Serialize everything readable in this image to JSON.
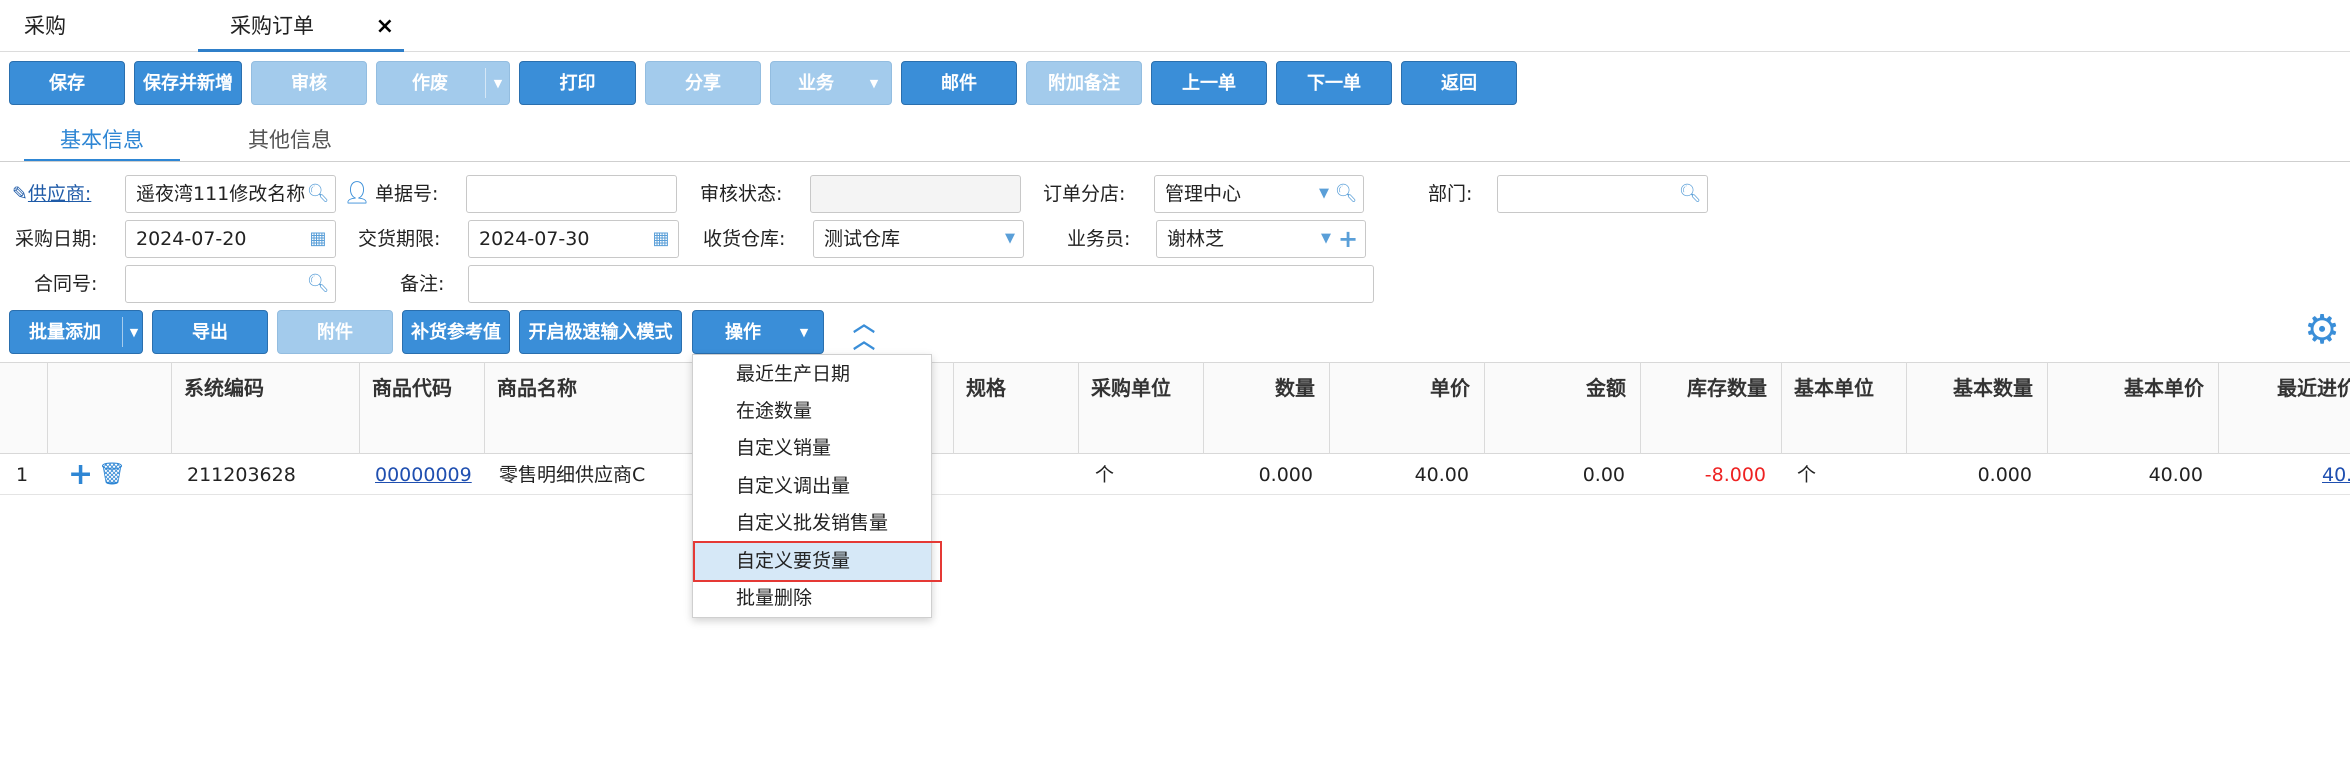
{
  "tabs": [
    {
      "label": "采购"
    },
    {
      "label": "采购订单",
      "close": "×"
    }
  ],
  "toolbar": {
    "save": "保存",
    "save_new": "保存并新增",
    "audit": "审核",
    "void": "作废",
    "print": "打印",
    "share": "分享",
    "business": "业务",
    "mail": "邮件",
    "attach_note": "附加备注",
    "prev": "上一单",
    "next": "下一单",
    "back": "返回"
  },
  "subtabs": {
    "basic": "基本信息",
    "other": "其他信息"
  },
  "form": {
    "supplier_label": "供应商:",
    "supplier_value": "遥夜湾111修改名称",
    "doc_no_label": "单据号:",
    "doc_no_value": "",
    "audit_status_label": "审核状态:",
    "audit_status_value": "",
    "branch_label": "订单分店:",
    "branch_value": "管理中心",
    "dept_label": "部门:",
    "dept_value": "",
    "purchase_date_label": "采购日期:",
    "purchase_date_value": "2024-07-20",
    "delivery_label": "交货期限:",
    "delivery_value": "2024-07-30",
    "warehouse_label": "收货仓库:",
    "warehouse_value": "测试仓库",
    "salesman_label": "业务员:",
    "salesman_value": "谢林芝",
    "contract_label": "合同号:",
    "contract_value": "",
    "remark_label": "备注:",
    "remark_value": ""
  },
  "actions": {
    "batch_add": "批量添加",
    "export": "导出",
    "attachment": "附件",
    "replenish": "补货参考值",
    "fast_input": "开启极速输入模式",
    "operate": "操作"
  },
  "table": {
    "headers": [
      "系统编码",
      "商品代码",
      "商品名称",
      "规格",
      "采购单位",
      "数量",
      "单价",
      "金额",
      "库存数量",
      "基本单位",
      "基本数量",
      "基本单价",
      "最近进价"
    ],
    "rows": [
      {
        "index": "1",
        "sys_code": "211203628",
        "product_code": "00000009",
        "product_name": "零售明细供应商C",
        "spec": "",
        "unit": "个",
        "qty": "0.000",
        "price": "40.00",
        "amount": "0.00",
        "stock": "-8.000",
        "base_unit": "个",
        "base_qty": "0.000",
        "base_price": "40.00",
        "last_price": "40."
      }
    ]
  },
  "menu": {
    "items": [
      "最近生产日期",
      "在途数量",
      "自定义销量",
      "自定义调出量",
      "自定义批发销售量",
      "自定义要货量",
      "批量删除"
    ],
    "highlighted_index": 5
  },
  "colors": {
    "accent": "#3a8ed8",
    "disabled": "#a3cbec",
    "negative": "#e22222",
    "highlight_box": "#e53935"
  }
}
